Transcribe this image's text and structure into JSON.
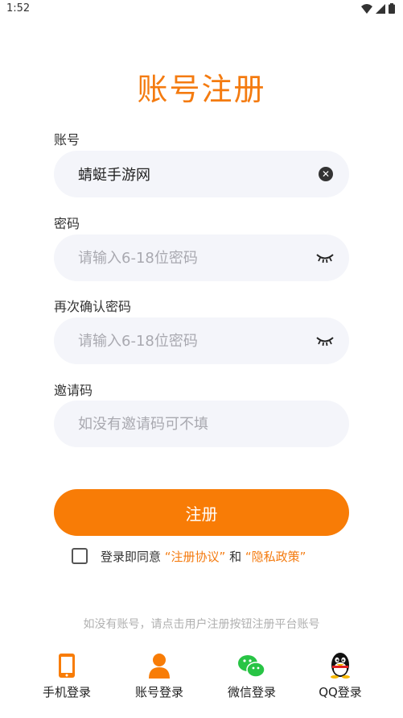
{
  "status_bar": {
    "time": "1:52"
  },
  "title": "账号注册",
  "account": {
    "label": "账号",
    "value": "蜻蜓手游网"
  },
  "password": {
    "label": "密码",
    "placeholder": "请输入6-18位密码"
  },
  "confirm_password": {
    "label": "再次确认密码",
    "placeholder": "请输入6-18位密码"
  },
  "invite": {
    "label": "邀请码",
    "placeholder": "如没有邀请码可不填"
  },
  "register_button": "注册",
  "agreement": {
    "prefix": "登录即同意 ",
    "link1": "“注册协议”",
    "middle": " 和 ",
    "link2": "“隐私政策”",
    "checked": false
  },
  "hint": "如没有账号，请点击用户注册按钮注册平台账号",
  "login_methods": [
    {
      "label": "手机登录",
      "icon": "phone-icon"
    },
    {
      "label": "账号登录",
      "icon": "user-icon"
    },
    {
      "label": "微信登录",
      "icon": "wechat-icon"
    },
    {
      "label": "QQ登录",
      "icon": "qq-icon"
    }
  ],
  "colors": {
    "accent": "#f87c06",
    "field_bg": "#f4f5fa",
    "wechat": "#28c445"
  }
}
